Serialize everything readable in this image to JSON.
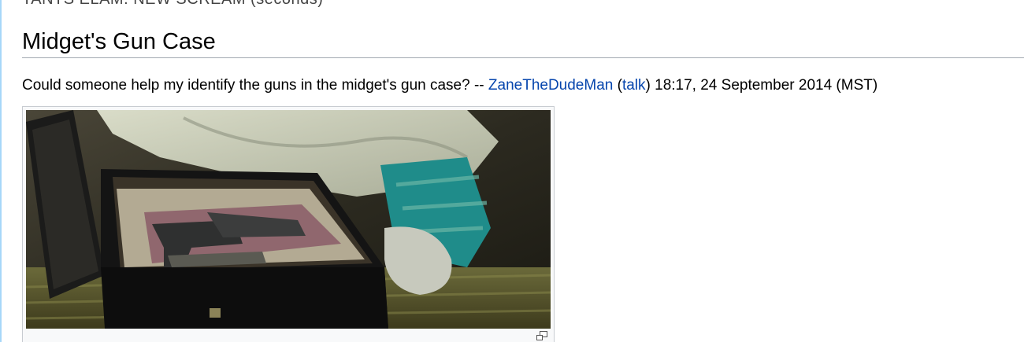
{
  "cut_line": "TANTS ELAM. NEW SCREAM (seconds)",
  "section": {
    "title": "Midget's Gun Case"
  },
  "comment": {
    "text": "Could someone help my identify the guns in the midget's gun case? -- ",
    "user_link": "ZaneTheDudeMan",
    "paren_open": " (",
    "talk_link": "talk",
    "paren_close_and_timestamp": ") 18:17, 24 September 2014 (MST)"
  },
  "thumbnail": {
    "magnify_icon": "magnify-clip-icon"
  },
  "colors": {
    "link": "#0645ad",
    "rule": "#a2a9b1",
    "left_border": "#a7d7f9"
  }
}
